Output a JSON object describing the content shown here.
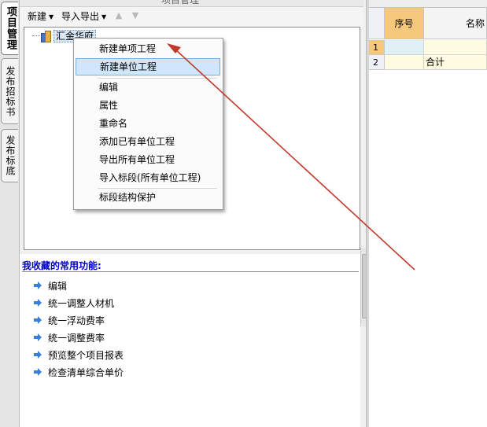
{
  "side_tabs": [
    {
      "label": "项目管理",
      "active": true
    },
    {
      "label": "发布招标书",
      "active": false
    },
    {
      "label": "发布标底",
      "active": false
    }
  ],
  "top_strip_text": "项目管理",
  "toolbar": {
    "new_label": "新建",
    "import_export_label": "导入导出",
    "up_icon": "arrow-up-icon",
    "down_icon": "arrow-down-icon"
  },
  "tree": {
    "root_label": "汇金华府",
    "root_icon": "building-icon"
  },
  "context_menu": {
    "items": [
      {
        "label": "新建单项工程",
        "highlighted": false
      },
      {
        "label": "新建单位工程",
        "highlighted": true
      },
      {
        "label": "编辑",
        "highlighted": false
      },
      {
        "label": "属性",
        "highlighted": false
      },
      {
        "label": "重命名",
        "highlighted": false
      },
      {
        "label": "添加已有单位工程",
        "highlighted": false
      },
      {
        "label": "导出所有单位工程",
        "highlighted": false
      },
      {
        "label": "导入标段(所有单位工程)",
        "highlighted": false
      },
      {
        "label": "标段结构保护",
        "highlighted": false
      }
    ]
  },
  "favorites": {
    "title": "我收藏的常用功能:",
    "items": [
      "编辑",
      "统一调整人材机",
      "统一浮动费率",
      "统一调整费率",
      "预览整个项目报表",
      "检查清单综合单价"
    ]
  },
  "grid": {
    "top_text": "",
    "headers": [
      "序号",
      "名称"
    ],
    "rows": [
      {
        "num": "1",
        "seq": "",
        "name": ""
      },
      {
        "num": "2",
        "seq": "",
        "name": "合计"
      }
    ]
  },
  "colors": {
    "accent_blue": "#0000cc",
    "menu_highlight": "#cfe6fc",
    "header_orange": "#f6c87c",
    "arrow_red": "#c0392b"
  }
}
